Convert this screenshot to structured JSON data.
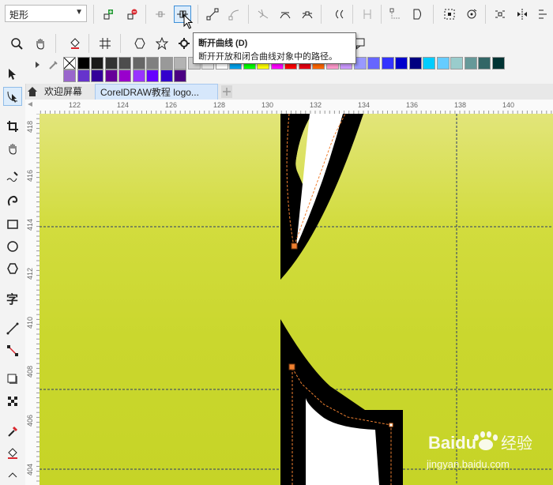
{
  "property_bar": {
    "mode_value": "矩形",
    "tools": [
      "add-node-icon",
      "delete-node-icon",
      "join-nodes-icon",
      "break-curve-icon",
      "to-line-icon",
      "to-curve-icon",
      "cusp-node-icon",
      "smooth-node-icon",
      "symmetric-node-icon",
      "reverse-direction-icon",
      "extend-curve-icon",
      "extract-subpath-icon",
      "close-curve-icon",
      "select-all-nodes-icon",
      "rotate-nodes-icon",
      "align-nodes-icon",
      "mirror-icon"
    ]
  },
  "tooltip": {
    "title": "断开曲线 (D)",
    "description": "断开开放和闭合曲线对象中的路径。"
  },
  "tabs": [
    {
      "label": "欢迎屏幕"
    },
    {
      "label": "CorelDRAW教程 logo..."
    }
  ],
  "palette": {
    "row1": [
      "#ffffff",
      "#000000",
      "#1a1a1a",
      "#333333",
      "#4d4d4d",
      "#666666",
      "#808080",
      "#999999",
      "#b3b3b3",
      "#cccccc",
      "#e6e6e6",
      "#ffffff",
      "#00a0e9",
      "#00ff00",
      "#ffff00",
      "#ff00ff",
      "#ff0000",
      "#e60012",
      "#ff6600",
      "#ff99cc",
      "#cc99ff",
      "#9999ff",
      "#6666ff",
      "#3333ff",
      "#0000cc",
      "#000080",
      "#00ccff",
      "#66ccff",
      "#99cccc",
      "#669999",
      "#336666",
      "#003333"
    ],
    "row2": [
      "#9966cc",
      "#6633cc",
      "#330099",
      "#660099",
      "#9900cc",
      "#9933ff",
      "#6600ff",
      "#3300cc",
      "#4b0082"
    ]
  },
  "rulers": {
    "h_ticks": [
      "122",
      "124",
      "126",
      "128",
      "130",
      "132",
      "134",
      "136",
      "138",
      "140"
    ],
    "v_ticks": [
      "418",
      "416",
      "414",
      "412",
      "410",
      "408",
      "406",
      "404"
    ]
  },
  "watermark": {
    "brand": "Baidu",
    "suffix": "经验",
    "url": "jingyan.baidu.com"
  },
  "colors": {
    "canvas_top": "#e2e57a",
    "canvas_bottom": "#c6d427",
    "accent": "#3d8fd8",
    "node": "#f08030"
  }
}
